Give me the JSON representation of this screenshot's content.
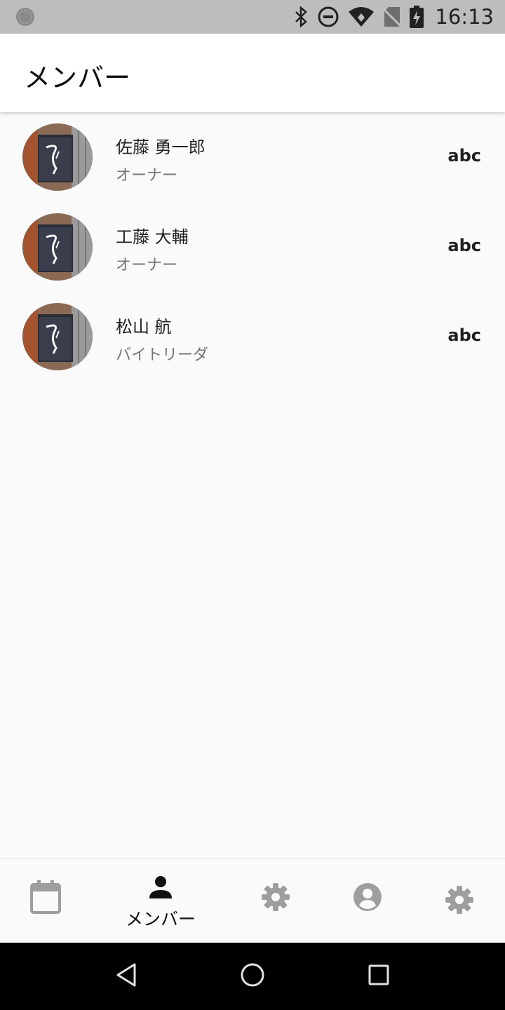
{
  "status_bar": {
    "time": "16:13"
  },
  "app_bar": {
    "title": "メンバー"
  },
  "members": [
    {
      "name": "佐藤 勇一郎",
      "role": "オーナー",
      "trailing": "abc"
    },
    {
      "name": "工藤 大輔",
      "role": "オーナー",
      "trailing": "abc"
    },
    {
      "name": "松山 航",
      "role": "バイトリーダ",
      "trailing": "abc"
    }
  ],
  "bottom_nav": {
    "active_index": 1,
    "items": [
      {
        "icon": "calendar-icon",
        "label": ""
      },
      {
        "icon": "person-icon",
        "label": "メンバー"
      },
      {
        "icon": "gear-icon",
        "label": ""
      },
      {
        "icon": "account-circle-icon",
        "label": ""
      },
      {
        "icon": "gear-icon",
        "label": ""
      }
    ]
  },
  "colors": {
    "status_bar": "#bdbdbd",
    "background": "#fafafa",
    "active_icon": "#111111",
    "inactive_icon": "#9e9e9e"
  }
}
